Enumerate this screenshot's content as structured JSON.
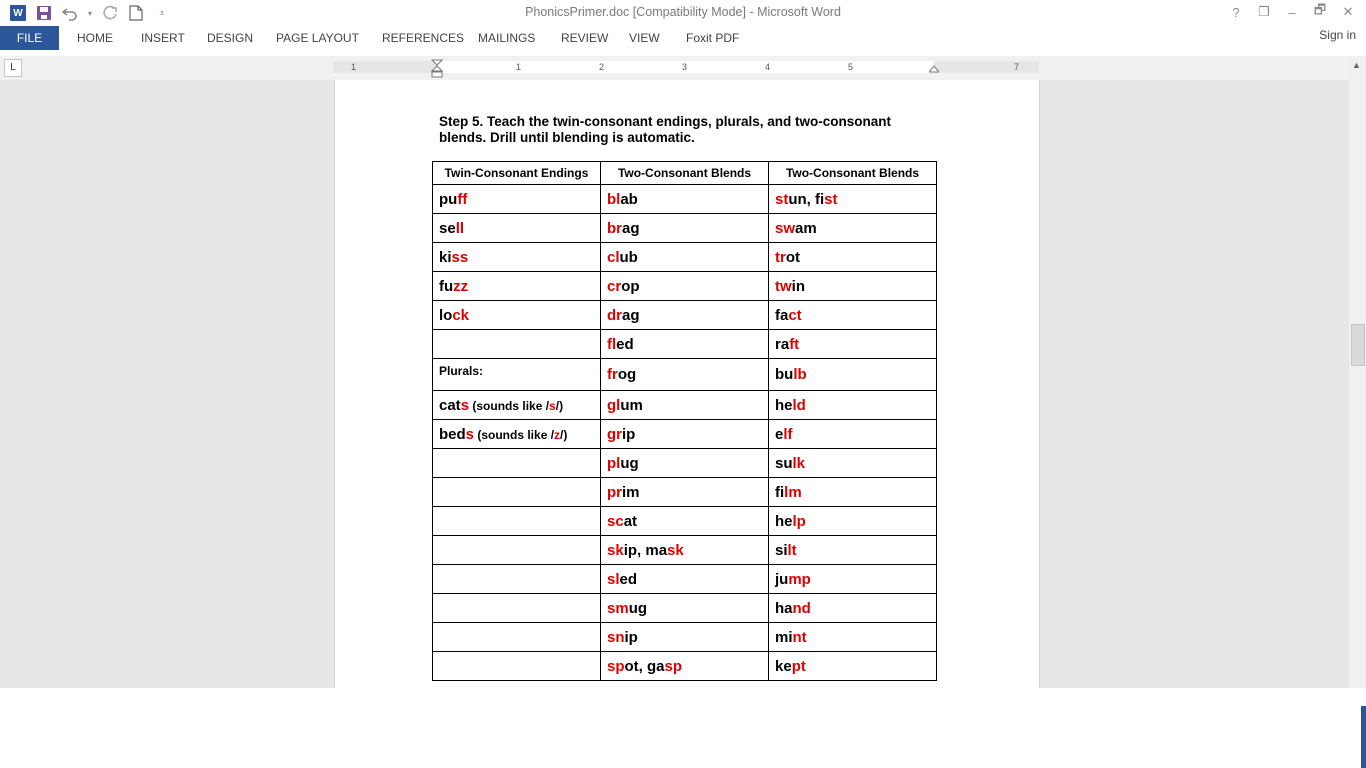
{
  "window": {
    "title": "PhonicsPrimer.doc [Compatibility Mode] - Microsoft Word",
    "controls": [
      "?",
      "❐",
      "–",
      "🗗",
      "✕"
    ]
  },
  "qat": {
    "undo_icon": "undo-icon",
    "redo_icon": "redo-icon"
  },
  "ribbon": {
    "tabs": [
      "FILE",
      "HOME",
      "INSERT",
      "DESIGN",
      "PAGE LAYOUT",
      "REFERENCES",
      "MAILINGS",
      "REVIEW",
      "VIEW",
      "Foxit PDF"
    ],
    "signin": "Sign in"
  },
  "ruler": {
    "numbers": [
      "1",
      "1",
      "2",
      "3",
      "4",
      "5",
      "7"
    ],
    "tab_selector": "L"
  },
  "colors": {
    "accent": "#2b579a",
    "highlight": "#e00000"
  },
  "document": {
    "step": "Step 5. Teach the twin-consonant endings, plurals, and two-consonant blends. Drill until blending is automatic.",
    "headers": [
      "Twin-Consonant Endings",
      "Two-Consonant Blends",
      "Two-Consonant Blends"
    ],
    "rows": [
      [
        [
          [
            "pu",
            0
          ],
          [
            "ff",
            1
          ]
        ],
        [
          [
            "bl",
            1
          ],
          [
            "ab",
            0
          ]
        ],
        [
          [
            "st",
            1
          ],
          [
            "un, fi",
            0
          ],
          [
            "st",
            1
          ]
        ]
      ],
      [
        [
          [
            "se",
            0
          ],
          [
            "ll",
            1
          ]
        ],
        [
          [
            "br",
            1
          ],
          [
            "ag",
            0
          ]
        ],
        [
          [
            "sw",
            1
          ],
          [
            "am",
            0
          ]
        ]
      ],
      [
        [
          [
            "ki",
            0
          ],
          [
            "ss",
            1
          ]
        ],
        [
          [
            "cl",
            1
          ],
          [
            "ub",
            0
          ]
        ],
        [
          [
            "tr",
            1
          ],
          [
            "ot",
            0
          ]
        ]
      ],
      [
        [
          [
            "fu",
            0
          ],
          [
            "zz",
            1
          ]
        ],
        [
          [
            "cr",
            1
          ],
          [
            "op",
            0
          ]
        ],
        [
          [
            "tw",
            1
          ],
          [
            "in",
            0
          ]
        ]
      ],
      [
        [
          [
            "lo",
            0
          ],
          [
            "ck",
            1
          ]
        ],
        [
          [
            "dr",
            1
          ],
          [
            "ag",
            0
          ]
        ],
        [
          [
            "fa",
            0
          ],
          [
            "ct",
            1
          ]
        ]
      ],
      [
        [],
        [
          [
            "fl",
            1
          ],
          [
            "ed",
            0
          ]
        ],
        [
          [
            "ra",
            0
          ],
          [
            "ft",
            1
          ]
        ]
      ],
      [
        [
          [
            "Plurals:",
            2
          ]
        ],
        [
          [
            "fr",
            1
          ],
          [
            "og",
            0
          ]
        ],
        [
          [
            "bu",
            0
          ],
          [
            "lb",
            1
          ]
        ]
      ],
      [
        [
          [
            "cat",
            0
          ],
          [
            "s",
            1
          ],
          [
            " (sounds like /",
            3
          ],
          [
            "s",
            4
          ],
          [
            "/)",
            3
          ]
        ],
        [
          [
            "gl",
            1
          ],
          [
            "um",
            0
          ]
        ],
        [
          [
            "he",
            0
          ],
          [
            "ld",
            1
          ]
        ]
      ],
      [
        [
          [
            "bed",
            0
          ],
          [
            "s",
            1
          ],
          [
            " (sounds like /",
            3
          ],
          [
            "z",
            4
          ],
          [
            "/)",
            3
          ]
        ],
        [
          [
            "gr",
            1
          ],
          [
            "ip",
            0
          ]
        ],
        [
          [
            "e",
            0
          ],
          [
            "lf",
            1
          ]
        ]
      ],
      [
        [],
        [
          [
            "pl",
            1
          ],
          [
            "ug",
            0
          ]
        ],
        [
          [
            "su",
            0
          ],
          [
            "lk",
            1
          ]
        ]
      ],
      [
        [],
        [
          [
            "pr",
            1
          ],
          [
            "im",
            0
          ]
        ],
        [
          [
            "fi",
            0
          ],
          [
            "lm",
            1
          ]
        ]
      ],
      [
        [],
        [
          [
            "sc",
            1
          ],
          [
            "at",
            0
          ]
        ],
        [
          [
            "he",
            0
          ],
          [
            "lp",
            1
          ]
        ]
      ],
      [
        [],
        [
          [
            "sk",
            1
          ],
          [
            "ip, ma",
            0
          ],
          [
            "sk",
            1
          ]
        ],
        [
          [
            "si",
            0
          ],
          [
            "lt",
            1
          ]
        ]
      ],
      [
        [],
        [
          [
            "sl",
            1
          ],
          [
            "ed",
            0
          ]
        ],
        [
          [
            "ju",
            0
          ],
          [
            "mp",
            1
          ]
        ]
      ],
      [
        [],
        [
          [
            "sm",
            1
          ],
          [
            "ug",
            0
          ]
        ],
        [
          [
            "ha",
            0
          ],
          [
            "nd",
            1
          ]
        ]
      ],
      [
        [],
        [
          [
            "sn",
            1
          ],
          [
            "ip",
            0
          ]
        ],
        [
          [
            "mi",
            0
          ],
          [
            "nt",
            1
          ]
        ]
      ],
      [
        [],
        [
          [
            "sp",
            1
          ],
          [
            "ot, ga",
            0
          ],
          [
            "sp",
            1
          ]
        ],
        [
          [
            "ke",
            0
          ],
          [
            "pt",
            1
          ]
        ]
      ]
    ]
  }
}
